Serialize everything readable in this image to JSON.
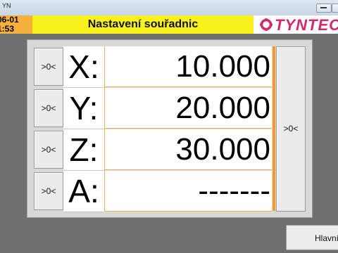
{
  "window": {
    "title": "YN"
  },
  "header": {
    "date": "-06-01",
    "time": "-1:53",
    "title": "Nastavení souřadnic",
    "logo_text": "TYNTEC"
  },
  "axes": [
    {
      "label": "X:",
      "value": "10.000",
      "zero_label": ">0<"
    },
    {
      "label": "Y:",
      "value": "20.000",
      "zero_label": ">0<"
    },
    {
      "label": "Z:",
      "value": "30.000",
      "zero_label": ">0<"
    },
    {
      "label": "A:",
      "value": "-------",
      "zero_label": ">0<"
    }
  ],
  "zero_all_label": ">0<",
  "footer": {
    "main_button": "Hlavní"
  },
  "colors": {
    "header_yellow": "#f9f21d",
    "date_orange": "#f6b03b",
    "logo_magenta": "#d8266a",
    "accent_orange": "#f39a2e"
  }
}
